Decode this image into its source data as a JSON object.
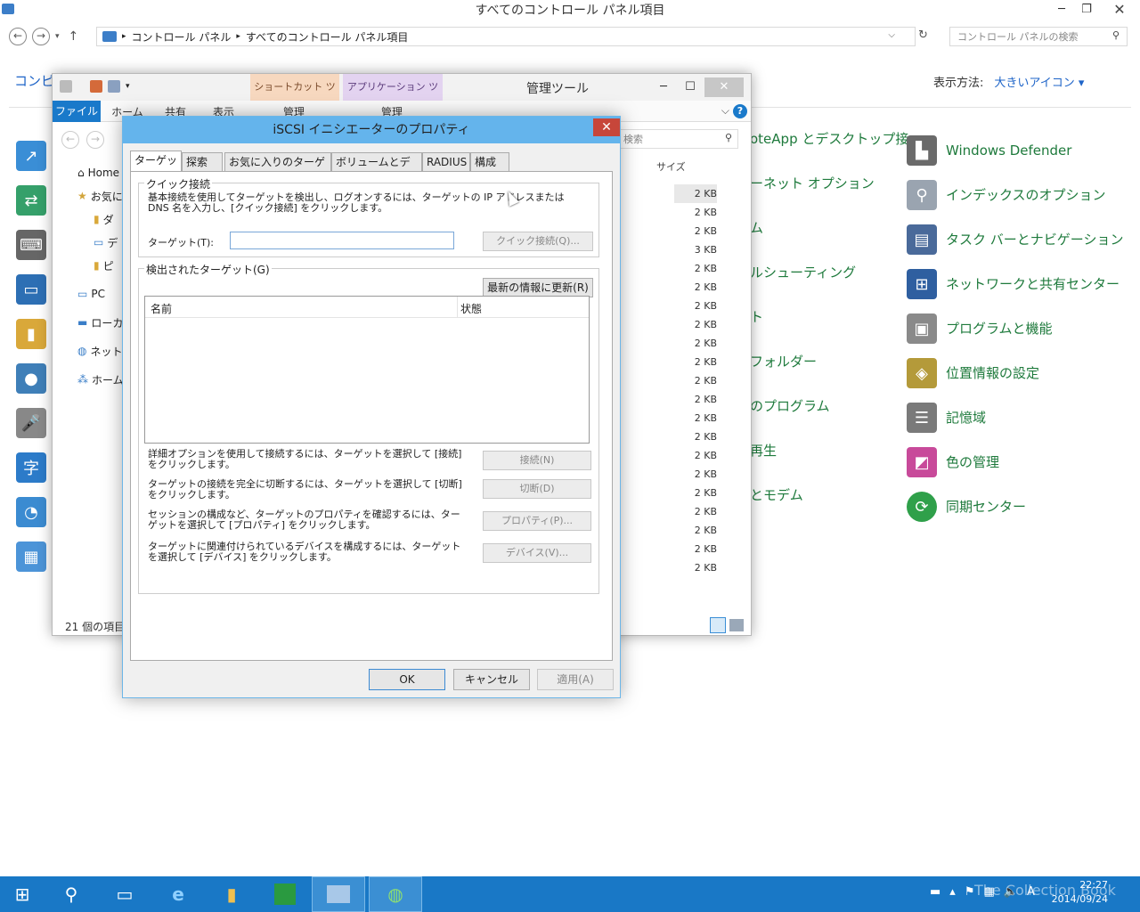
{
  "cp": {
    "title": "すべてのコントロール パネル項目",
    "breadcrumb1": "コントロール パネル",
    "breadcrumb2": "すべてのコントロール パネル項目",
    "search_placeholder": "コントロール パネルの検索",
    "heading_partial": "コンピ",
    "view_label": "表示方法:",
    "view_value": "大きいアイコン ▾",
    "items_mid": [
      "oteApp とデスクトップ接",
      "ーネット オプション",
      "ム",
      "ルシューティング",
      "ト",
      "フォルダー",
      "のプログラム",
      "再生",
      "とモデム"
    ],
    "items_right": [
      "Windows Defender",
      "インデックスのオプション",
      "タスク バーとナビゲーション",
      "ネットワークと共有センター",
      "プログラムと機能",
      "位置情報の設定",
      "記憶域",
      "色の管理",
      "同期センター"
    ]
  },
  "ex": {
    "title": "管理ツール",
    "ctx1": "ショートカット ツール",
    "ctx2": "アプリケーション ツール",
    "ctx1_sub": "管理",
    "ctx2_sub": "管理",
    "tab_file": "ファイル",
    "tab_home": "ホーム",
    "tab_share": "共有",
    "tab_view": "表示",
    "search": "検索",
    "col_size": "サイズ",
    "side": [
      "Home",
      "お気に",
      "ダ",
      "デ",
      "ピ",
      "PC",
      "ローカ",
      "ネット",
      "ホーム"
    ],
    "sizes": [
      "2 KB",
      "2 KB",
      "2 KB",
      "3 KB",
      "2 KB",
      "2 KB",
      "2 KB",
      "2 KB",
      "2 KB",
      "2 KB",
      "2 KB",
      "2 KB",
      "2 KB",
      "2 KB",
      "2 KB",
      "2 KB",
      "2 KB",
      "2 KB",
      "2 KB",
      "2 KB",
      "2 KB"
    ],
    "status": "21 個の項目"
  },
  "dlg": {
    "title": "iSCSI イニシエーターのプロパティ",
    "tabs": [
      "ターゲット",
      "探索",
      "お気に入りのターゲット",
      "ボリュームとデバイス",
      "RADIUS",
      "構成"
    ],
    "quick_label": "クイック接続",
    "quick_desc": "基本接続を使用してターゲットを検出し、ログオンするには、ターゲットの IP アドレスまたは DNS 名を入力し、[クイック接続] をクリックします。",
    "target_label": "ターゲット(T):",
    "target_value": "",
    "quick_btn": "クイック接続(Q)...",
    "found_label": "検出されたターゲット(G)",
    "refresh_btn": "最新の情報に更新(R)",
    "col_name": "名前",
    "col_state": "状態",
    "d1": "詳細オプションを使用して接続するには、ターゲットを選択して [接続] をクリックします。",
    "b1": "接続(N)",
    "d2": "ターゲットの接続を完全に切断するには、ターゲットを選択して [切断] をクリックします。",
    "b2": "切断(D)",
    "d3": "セッションの構成など、ターゲットのプロパティを確認するには、ターゲットを選択して [プロパティ] をクリックします。",
    "b3": "プロパティ(P)...",
    "d4": "ターゲットに関連付けられているデバイスを構成するには、ターゲットを選択して [デバイス] をクリックします。",
    "b4": "デバイス(V)...",
    "ok": "OK",
    "cancel": "キャンセル",
    "apply": "適用(A)"
  },
  "tb": {
    "time": "22:27",
    "date": "2014/09/24",
    "watermark": "The Collection Book",
    "ime": "A"
  }
}
